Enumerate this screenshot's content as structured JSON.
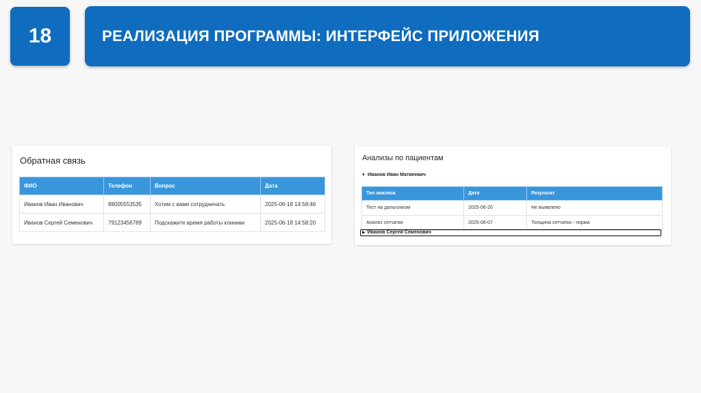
{
  "slide": {
    "number": "18",
    "title": "РЕАЛИЗАЦИЯ ПРОГРАММЫ: ИНТЕРФЕЙС ПРИЛОЖЕНИЯ"
  },
  "feedback": {
    "heading": "Обратная связь",
    "columns": [
      "ФИО",
      "Телефон",
      "Вопрос",
      "Дата"
    ],
    "rows": [
      [
        "Иванов Иван Иванович",
        "88005553535",
        "Хотим с вами сотрудничать",
        "2025-06-18 14:58:46"
      ],
      [
        "Иванов Сергей Семенович",
        "79123456789",
        "Подскажите время работы клиники",
        "2025-06-18 14:58:20"
      ]
    ]
  },
  "analyses": {
    "heading": "Анализы по пациентам",
    "expanded_marker": "▼",
    "collapsed_marker": "▶",
    "patients": [
      {
        "name": "Иванов Иван Матвеевич",
        "columns": [
          "Тип анализа",
          "Дата",
          "Результат"
        ],
        "rows": [
          [
            "Тест на дальтонизм",
            "2025-06-20",
            "Не выявлено"
          ],
          [
            "Анализ сетчатки",
            "2025-06-07",
            "Толщина сетчатки - норма"
          ]
        ]
      },
      {
        "name": "Иванов Сергей Семенович"
      }
    ]
  },
  "colors": {
    "brand_blue": "#0f6cbf",
    "table_header": "#3a96db"
  }
}
